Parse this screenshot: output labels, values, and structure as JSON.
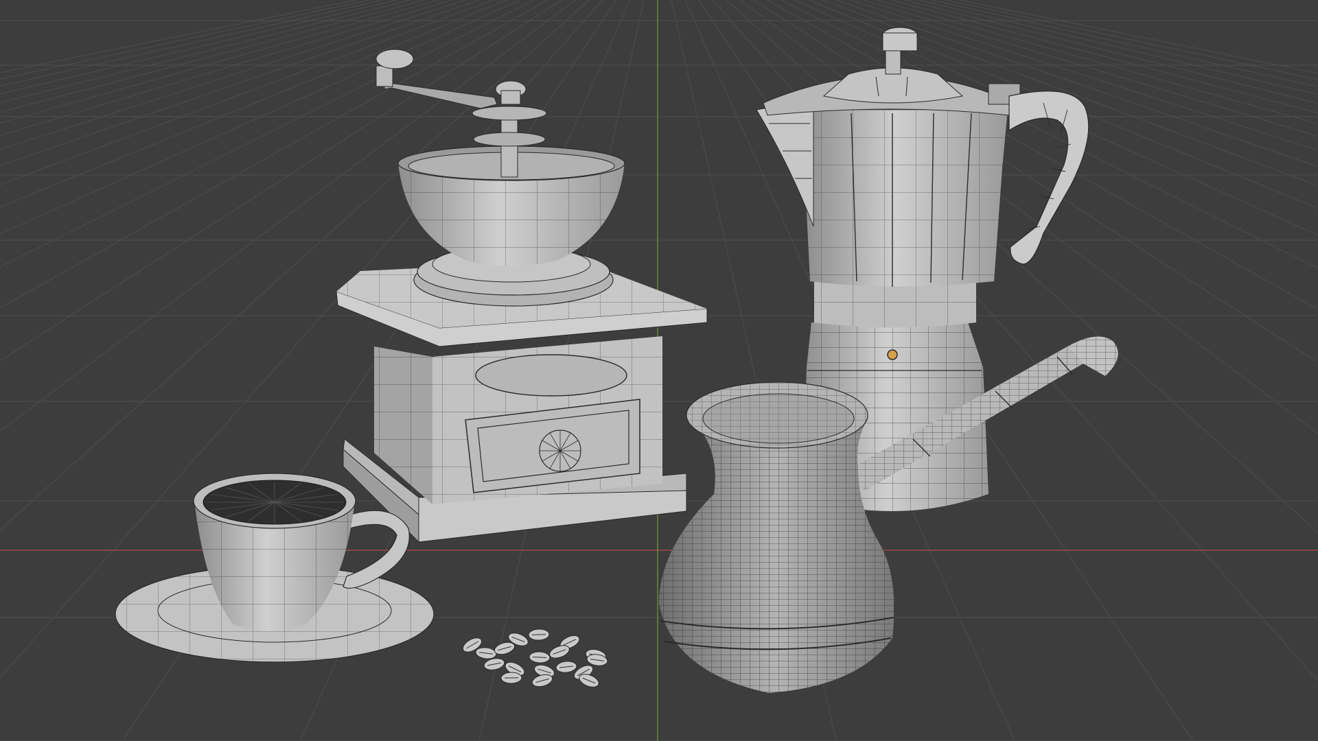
{
  "viewport": {
    "background": "#3d3d3d",
    "grid_color": "#4b4b4b",
    "x_axis_color": "#9a4a4a",
    "y_axis_color": "#6e8a3a",
    "shading": "solid-with-wireframe",
    "mesh_color": "#c9c9c9",
    "wire_color": "#2a2a2a"
  },
  "scene_objects": [
    {
      "name": "coffee-grinder",
      "icon": "coffee-grinder-icon"
    },
    {
      "name": "moka-pot",
      "icon": "moka-pot-icon"
    },
    {
      "name": "cezve",
      "icon": "cezve-icon"
    },
    {
      "name": "coffee-cup",
      "icon": "cup-icon"
    },
    {
      "name": "saucer",
      "icon": "saucer-icon"
    },
    {
      "name": "coffee-beans",
      "icon": "bean-icon"
    }
  ]
}
